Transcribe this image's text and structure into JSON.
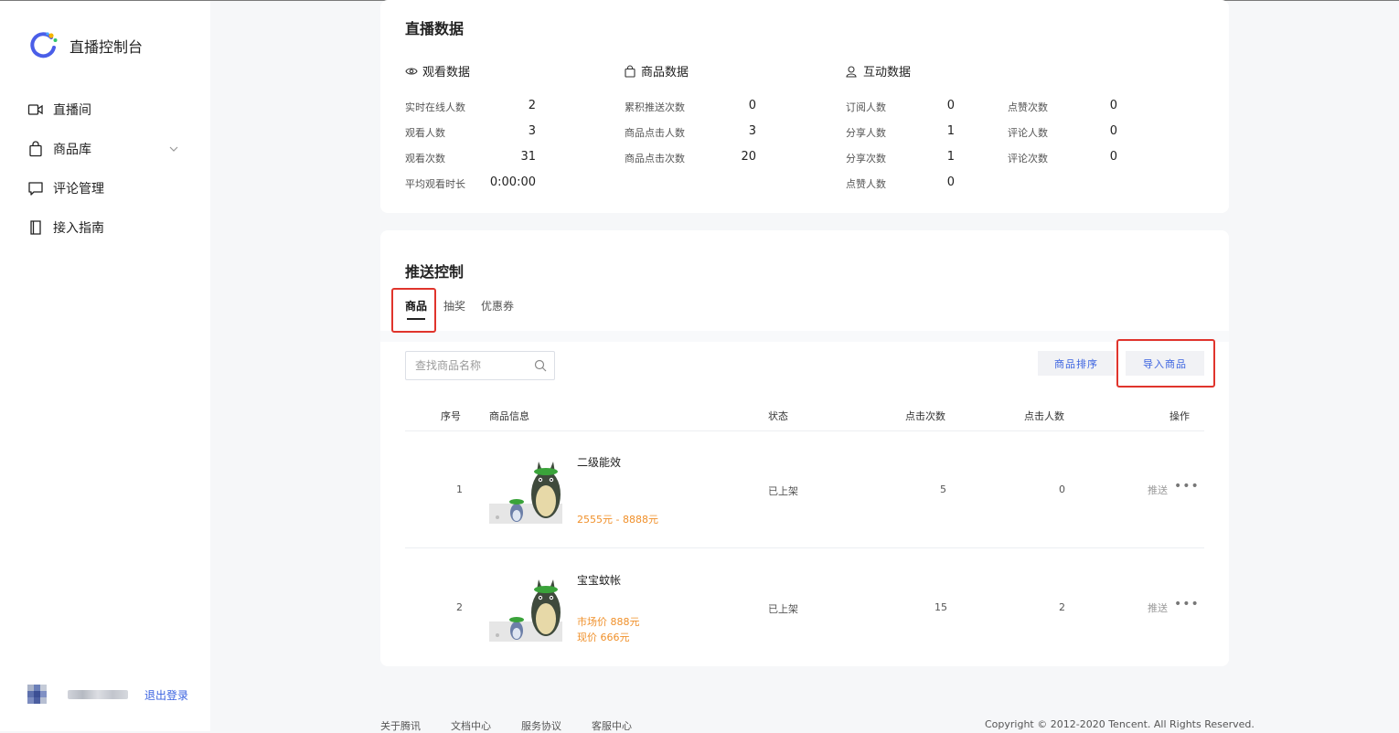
{
  "sidebar": {
    "title": "直播控制台",
    "items": [
      {
        "label": "直播间",
        "icon": "video-camera-icon"
      },
      {
        "label": "商品库",
        "icon": "shopping-bag-icon"
      },
      {
        "label": "评论管理",
        "icon": "comment-icon"
      },
      {
        "label": "接入指南",
        "icon": "book-icon"
      }
    ],
    "logout": "退出登录"
  },
  "live_data": {
    "title": "直播数据",
    "watch": {
      "title": "观看数据",
      "rows": [
        {
          "label": "实时在线人数",
          "value": "2"
        },
        {
          "label": "观看人数",
          "value": "3"
        },
        {
          "label": "观看次数",
          "value": "31"
        },
        {
          "label": "平均观看时长",
          "value": "0:00:00"
        }
      ]
    },
    "goods": {
      "title": "商品数据",
      "rows": [
        {
          "label": "累积推送次数",
          "value": "0"
        },
        {
          "label": "商品点击人数",
          "value": "3"
        },
        {
          "label": "商品点击次数",
          "value": "20"
        }
      ]
    },
    "interact": {
      "title": "互动数据",
      "col1": [
        {
          "label": "订阅人数",
          "value": "0"
        },
        {
          "label": "分享人数",
          "value": "1"
        },
        {
          "label": "分享次数",
          "value": "1"
        },
        {
          "label": "点赞人数",
          "value": "0"
        }
      ],
      "col2": [
        {
          "label": "点赞次数",
          "value": "0"
        },
        {
          "label": "评论人数",
          "value": "0"
        },
        {
          "label": "评论次数",
          "value": "0"
        }
      ]
    }
  },
  "push_control": {
    "title": "推送控制",
    "tabs": [
      "商品",
      "抽奖",
      "优惠券"
    ],
    "search_placeholder": "查找商品名称",
    "sort_button": "商品排序",
    "import_button": "导入商品",
    "table": {
      "headers": [
        "序号",
        "商品信息",
        "状态",
        "点击次数",
        "点击人数",
        "操作"
      ],
      "rows": [
        {
          "index": "1",
          "name": "二级能效",
          "price1": "2555元 - 8888元",
          "price2": "",
          "status": "已上架",
          "clicks": "5",
          "users": "0",
          "action": "推送"
        },
        {
          "index": "2",
          "name": "宝宝蚊帐",
          "price1": "市场价 888元",
          "price2": "现价 666元",
          "status": "已上架",
          "clicks": "15",
          "users": "2",
          "action": "推送"
        }
      ]
    }
  },
  "footer": {
    "links": [
      "关于腾讯",
      "文档中心",
      "服务协议",
      "客服中心"
    ],
    "copyright": "Copyright © 2012-2020 Tencent. All Rights Reserved."
  },
  "colors": {
    "accent": "#3b63e0",
    "price": "#f0902a",
    "highlight": "#e0342c"
  }
}
